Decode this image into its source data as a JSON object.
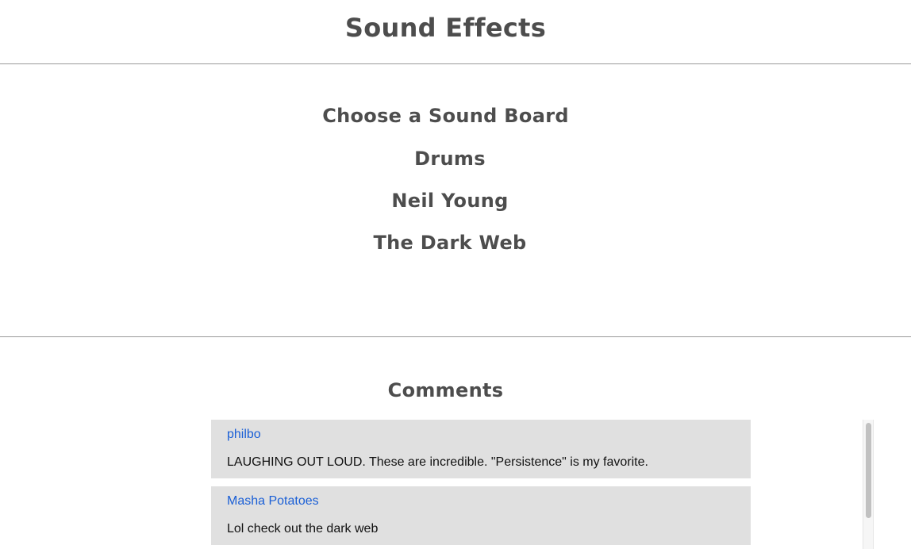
{
  "header": {
    "title": "Sound Effects"
  },
  "boards": {
    "heading": "Choose a Sound Board",
    "items": [
      {
        "label": "Drums"
      },
      {
        "label": "Neil Young"
      },
      {
        "label": "The Dark Web"
      }
    ]
  },
  "comments": {
    "title": "Comments",
    "items": [
      {
        "author": "philbo",
        "text": "LAUGHING OUT LOUD. These are incredible. \"Persistence\" is my favorite."
      },
      {
        "author": "Masha Potatoes",
        "text": "Lol check out the dark web"
      }
    ]
  },
  "colors": {
    "heading": "#4d4d4d",
    "author_link": "#1a5fd6",
    "comment_bg": "#e0e0e0",
    "rule": "#999999"
  }
}
